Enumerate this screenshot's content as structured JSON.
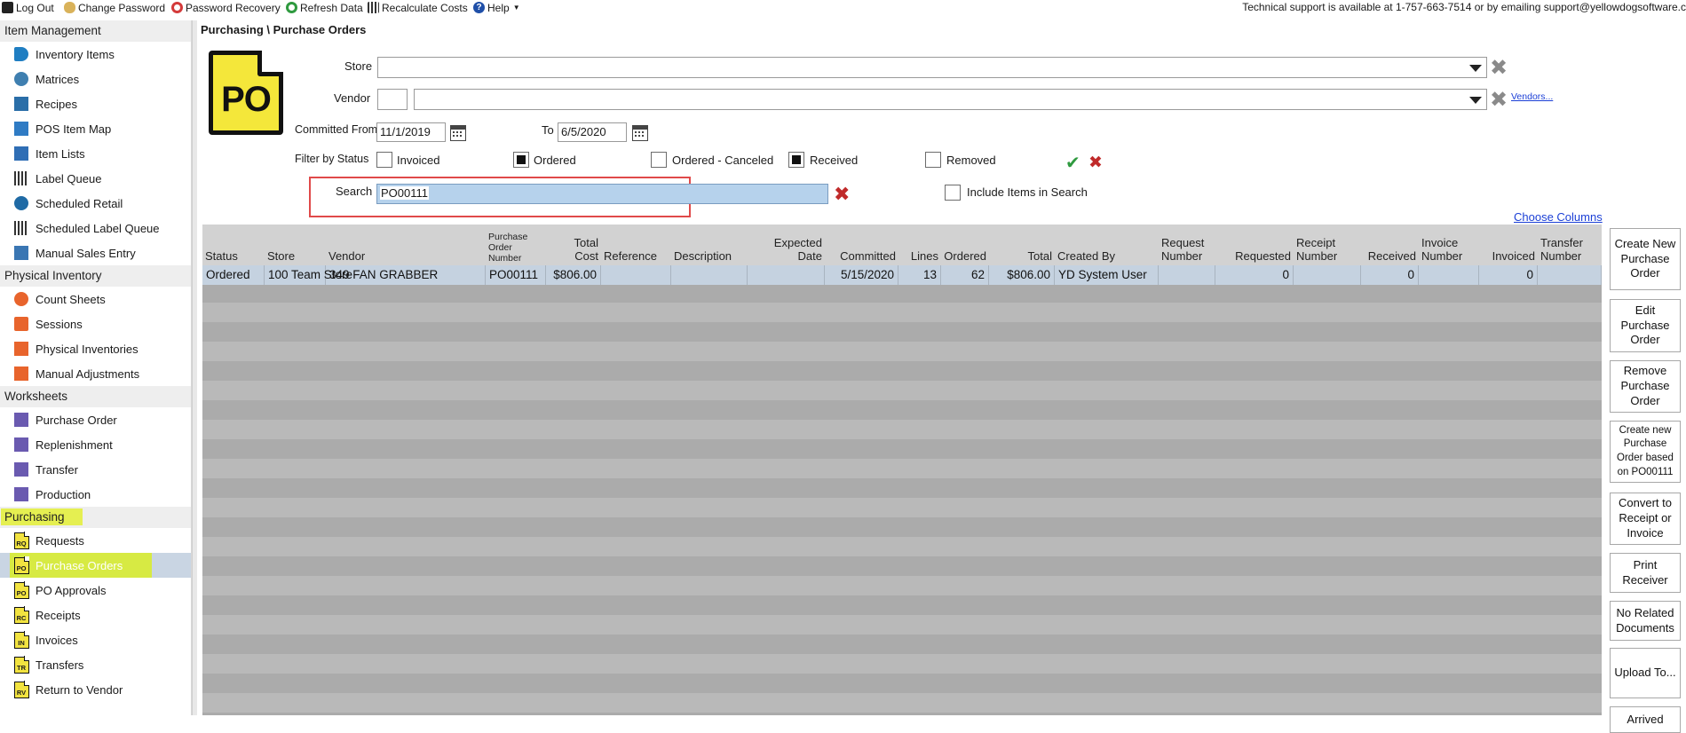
{
  "toolbar": {
    "logout": "Log Out",
    "change_password": "Change Password",
    "password_recovery": "Password Recovery",
    "refresh": "Refresh Data",
    "recalc": "Recalculate Costs",
    "help": "Help",
    "support": "Technical support is available at 1-757-663-7514 or by emailing support@yellowdogsoftware.c"
  },
  "sidebar": {
    "sections": [
      {
        "title": "Item Management",
        "items": [
          "Inventory Items",
          "Matrices",
          "Recipes",
          "POS Item Map",
          "Item Lists",
          "Label Queue",
          "Scheduled Retail",
          "Scheduled Label Queue",
          "Manual Sales Entry"
        ]
      },
      {
        "title": "Physical Inventory",
        "items": [
          "Count Sheets",
          "Sessions",
          "Physical Inventories",
          "Manual Adjustments"
        ]
      },
      {
        "title": "Worksheets",
        "items": [
          "Purchase Order",
          "Replenishment",
          "Transfer",
          "Production"
        ]
      },
      {
        "title": "Purchasing",
        "items": [
          "Requests",
          "Purchase Orders",
          "PO Approvals",
          "Receipts",
          "Invoices",
          "Transfers",
          "Return to Vendor"
        ]
      }
    ],
    "po_icon_codes": [
      "RQ",
      "PO",
      "PO",
      "RC",
      "IN",
      "TR",
      "RV"
    ]
  },
  "breadcrumb": "Purchasing \\ Purchase Orders",
  "big_icon_text": "PO",
  "filters": {
    "store_label": "Store",
    "store_value": "",
    "vendor_label": "Vendor",
    "vendor_code": "",
    "vendor_value": "",
    "vendors_link": "Vendors...",
    "committed_from_label": "Committed From",
    "committed_from": "11/1/2019",
    "to_label": "To",
    "to": "6/5/2020",
    "filter_status_label": "Filter by Status",
    "statuses": [
      {
        "label": "Invoiced",
        "checked": false
      },
      {
        "label": "Ordered",
        "checked": true
      },
      {
        "label": "Ordered - Canceled",
        "checked": false
      },
      {
        "label": "Received",
        "checked": true
      },
      {
        "label": "Removed",
        "checked": false
      }
    ],
    "search_label": "Search",
    "search_value": "PO00111",
    "include_items_label": "Include Items in Search",
    "include_items_checked": false,
    "choose_columns": "Choose Columns"
  },
  "grid": {
    "columns": [
      "Status",
      "Store",
      "Vendor",
      "Purchase Order Number",
      "Total Cost",
      "Reference",
      "Description",
      "Expected Date",
      "Committed",
      "Lines",
      "Ordered",
      "Total",
      "Created By",
      "Request Number",
      "Requested",
      "Receipt Number",
      "Received",
      "Invoice Number",
      "Invoiced",
      "Transfer Number"
    ],
    "rows": [
      [
        "Ordered",
        "100 Team Store",
        "349 FAN GRABBER",
        "PO00111",
        "$806.00",
        "",
        "",
        "",
        "5/15/2020",
        "13",
        "62",
        "$806.00",
        "YD System User",
        "",
        "0",
        "",
        "0",
        "",
        "0",
        ""
      ]
    ]
  },
  "actions": [
    "Create New Purchase Order",
    "Edit Purchase Order",
    "Remove Purchase Order",
    "Create new Purchase Order based on PO00111",
    "Convert to Receipt or Invoice",
    "Print Receiver",
    "No Related Documents",
    "Upload To...",
    "Arrived"
  ],
  "colors": {
    "highlight": "#e5ef51",
    "selected_row": "#c5d2e0",
    "po_yellow": "#f4e73a",
    "accent_red": "#c02a2a",
    "link_blue": "#1b3fd6"
  }
}
